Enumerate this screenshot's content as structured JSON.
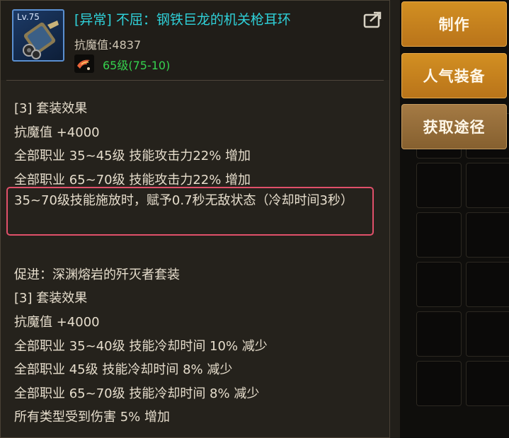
{
  "item": {
    "level_badge": "Lv.75",
    "title": "[异常] 不屈：钢铁巨龙的机关枪耳环",
    "resist_label": "抗魔值:",
    "resist_value": "4837",
    "level_text": "65级(75-10)"
  },
  "effects": {
    "set_title_1": "[3] 套装效果",
    "line_resist_1": "抗魔值 +4000",
    "line_atk_35_45": "全部职业 35~45级 技能攻击力22% 增加",
    "line_atk_65_70": "全部职业 65~70级 技能攻击力22% 增加",
    "line_invincible": "35~70级技能施放时，赋予0.7秒无敌状态（冷却时间3秒）",
    "promote": "促进：深渊熔岩的歼灭者套装",
    "set_title_2": "[3] 套装效果",
    "line_resist_2": "抗魔值 +4000",
    "line_cd_35_40": "全部职业 35~40级 技能冷却时间 10% 减少",
    "line_cd_45": "全部职业 45级 技能冷却时间 8% 减少",
    "line_cd_65_70": "全部职业 65~70级 技能冷却时间 8% 减少",
    "line_dmg": "所有类型受到伤害 5% 增加"
  },
  "buttons": {
    "craft": "制作",
    "popular": "人气装备",
    "acquire": "获取途径"
  },
  "icons": {
    "item": "machine-gun-earring-icon",
    "share": "share-icon",
    "level": "flame-bird-icon"
  },
  "colors": {
    "title": "#2fd0d8",
    "level": "#35d24e",
    "highlight": "#e0506a",
    "button": "#c8851f"
  }
}
